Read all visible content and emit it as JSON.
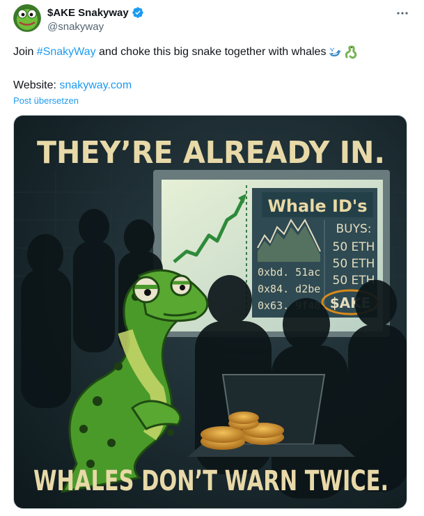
{
  "author": {
    "display_name": "$AKE Snakyway",
    "handle": "@snakyway",
    "verified": true,
    "verified_color": "#1d9bf0"
  },
  "tweet": {
    "text_before": "Join ",
    "hashtag": "#SnakyWay",
    "text_after": " and choke this big snake together with whales",
    "emojis": [
      "whale-icon",
      "snake-icon"
    ],
    "website_label": "Website: ",
    "website_link": "snakyway.com",
    "translate_label": "Post übersetzen"
  },
  "media": {
    "headline_top": "THEY’RE ALREADY IN.",
    "headline_bottom": "WHALES DON’T WARN TWICE.",
    "screen_title": "Whale ID's",
    "buys_header": "BUYS:",
    "wallets": [
      "0xbd. 51ac",
      "0x84. d2be",
      "0x63. 9f40."
    ],
    "buys": [
      "50 ETH",
      "50 ETH",
      "50 ETH"
    ],
    "ticker": "$AKE"
  },
  "colors": {
    "accent": "#1d9bf0",
    "headline": "#e8d9a8",
    "snake_green": "#4a9a2a",
    "ticker_circle": "#d98a1a"
  }
}
